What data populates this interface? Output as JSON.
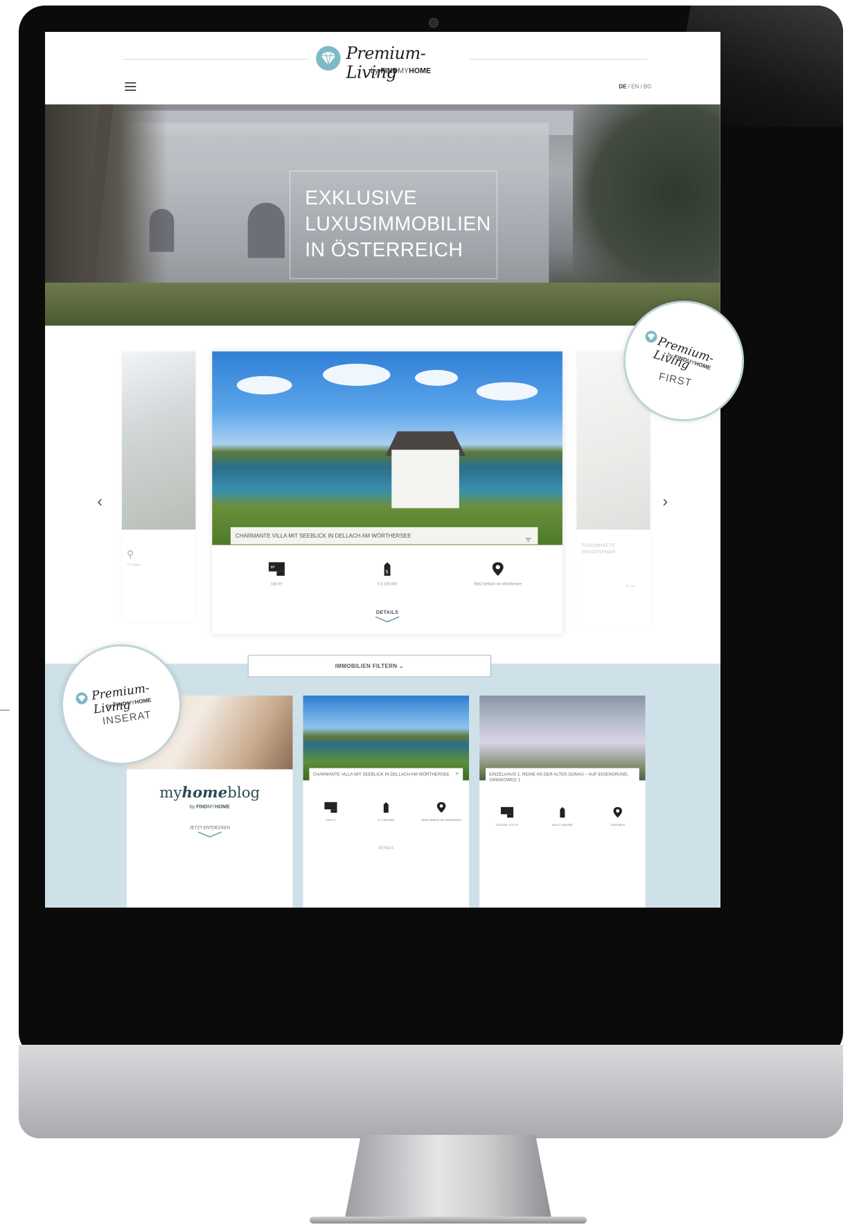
{
  "header": {
    "logo_script": "Premium-Living",
    "logo_by": "by",
    "logo_find": "FIND",
    "logo_my": "MY",
    "logo_home": "HOME",
    "lang_de": "DE",
    "lang_rest": " / EN / BG"
  },
  "hero": {
    "title": "EXKLUSIVE\nLUXUSIMMOBILIEN\nIN ÖSTERREICH"
  },
  "carousel": {
    "featured": {
      "caption": "CHARMANTE VILLA MIT SEEBLICK IN DELLACH AM WÖRTHERSEE",
      "area": "183 m²",
      "price": "€ 3.100.000",
      "location": "9062 Dellach am Wörthersee",
      "details_label": "DETAILS"
    },
    "right_card_caption": "TRAUMHAFTE PRIVATSPHÄR",
    "right_card_area": "37 m²",
    "left_card_location": "72 Wien"
  },
  "badges": {
    "first_script": "Premium-Living",
    "first_sub_by": "by",
    "first_sub_find": "FIND",
    "first_sub_my": "MY",
    "first_sub_home": "HOME",
    "first_label": "FIRST",
    "inserat_script": "Premium-Living",
    "inserat_sub_by": "by",
    "inserat_sub_find": "FIND",
    "inserat_sub_my": "MY",
    "inserat_sub_home": "HOME",
    "inserat_label": "INSERAT"
  },
  "filter": {
    "label": "IMMOBILIEN FILTERN",
    "chevron": "⌄"
  },
  "blog": {
    "title_prefix": "my",
    "title_home": "home",
    "title_suffix": "blog",
    "sub_by": "by",
    "sub_find": "FIND",
    "sub_my": "MY",
    "sub_home": "HOME",
    "cta": "JETZT ENTDECKEN"
  },
  "tiles": [
    {
      "caption": "CHARMANTE VILLA MIT SEEBLICK IN DELLACH AM WÖRTHERSEE",
      "area": "183 m²",
      "price": "€ 3.100.000",
      "location": "9062 Dellach am Wörthersee",
      "details": "DETAILS"
    },
    {
      "caption": "EINZELHAUS 1. REIHE AN DER ALTEN DONAU – AUF EIGENGRUND, GINGKOWEG 1",
      "area": "143 bzw. 173 m²",
      "price": "ab € 2.199.900",
      "location": "1220 Wien"
    }
  ],
  "icons": {
    "menu": "menu-icon",
    "diamond": "diamond-icon",
    "area": "area-icon",
    "price": "price-tag-icon",
    "location": "location-pin-icon",
    "wifi": "wifi-icon",
    "prev": "‹",
    "next": "›",
    "pin_glyph": "⚲",
    "wifi_glyph": "ᯤ"
  },
  "colors": {
    "accent": "#cfe1e8",
    "border": "#8fb0bb",
    "diamond": "#7fb8c6"
  }
}
